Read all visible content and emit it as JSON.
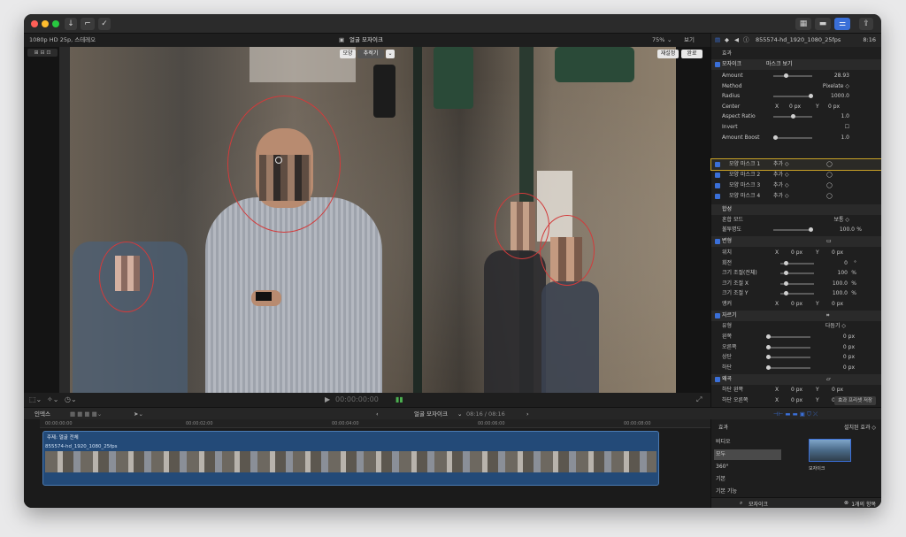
{
  "titlebar": {
    "buttons": [
      "↓",
      "⌐",
      "✓"
    ],
    "right_views": [
      "▦",
      "▬",
      "⚌"
    ]
  },
  "subbar": {
    "format": "1080p HD 25p, 스테레오",
    "clip_name": "얼굴 모자이크",
    "zoom": "75%",
    "view": "보기"
  },
  "viewer": {
    "shape_btn": "모양",
    "track_btn": "추적기",
    "replay_btn": "재설정",
    "done_btn": "완료",
    "timecode": "00:00:00:00"
  },
  "inspector": {
    "clip_id": "855574-hd_1920_1080_25fps",
    "duration": "8:16",
    "effects_title": "효과",
    "mosaic": {
      "name": "모자이크",
      "mask_view": "마스크 보기"
    },
    "params": [
      {
        "label": "Amount",
        "value": "28.93",
        "level": 0.3
      },
      {
        "label": "Method",
        "value": "Pixelate ◇"
      },
      {
        "label": "Radius",
        "value": "1000.0",
        "level": 1.0
      },
      {
        "label": "Center",
        "x_label": "X",
        "x": "0 px",
        "y_label": "Y",
        "y": "0 px"
      },
      {
        "label": "Aspect Ratio",
        "value": "1.0",
        "level": 0.5
      },
      {
        "label": "Invert",
        "value": "☐"
      },
      {
        "label": "Amount Boost",
        "value": "1.0",
        "level": 0.0
      }
    ],
    "masks": [
      {
        "name": "모양 마스크 1",
        "add": "추가 ◇"
      },
      {
        "name": "모양 마스크 2",
        "add": "추가 ◇"
      },
      {
        "name": "모양 마스크 3",
        "add": "추가 ◇"
      },
      {
        "name": "모양 마스크 4",
        "add": "추가 ◇"
      }
    ],
    "composite": {
      "title": "합성",
      "blend_label": "혼합 모드",
      "blend_value": "보통 ◇",
      "opacity_label": "불투명도",
      "opacity_value": "100.0",
      "opacity_unit": "%"
    },
    "transform": {
      "title": "변형",
      "rows": [
        {
          "label": "위치",
          "x": "0 px",
          "y": "0 px"
        },
        {
          "label": "회전",
          "value": "0",
          "unit": "°"
        },
        {
          "label": "크기 조절(전체)",
          "value": "100",
          "unit": "%"
        },
        {
          "label": "크기 조절 X",
          "value": "100.0",
          "unit": "%"
        },
        {
          "label": "크기 조절 Y",
          "value": "100.0",
          "unit": "%"
        },
        {
          "label": "앵커",
          "x": "0 px",
          "y": "0 px"
        }
      ]
    },
    "crop": {
      "title": "자르기",
      "type_label": "유형",
      "type_value": "다듬기 ◇",
      "rows": [
        {
          "label": "왼쪽",
          "value": "0 px"
        },
        {
          "label": "오른쪽",
          "value": "0 px"
        },
        {
          "label": "상단",
          "value": "0 px"
        },
        {
          "label": "하단",
          "value": "0 px"
        }
      ]
    },
    "distort": {
      "title": "왜곡",
      "rows": [
        {
          "label": "하단 왼쪽",
          "x": "0 px",
          "y": "0 px"
        },
        {
          "label": "하단 오른쪽",
          "x": "0 px",
          "y": "0 px"
        }
      ]
    },
    "save_preset": "효과 프리셋 저장"
  },
  "timeline_bar": {
    "index": "인덱스",
    "project": "얼굴 모자이크",
    "position": "08:16 / 08:16"
  },
  "timeline": {
    "ruler": [
      "00:00:00:00",
      "00:00:02:00",
      "00:00:04:00",
      "00:00:06:00",
      "00:00:08:00"
    ],
    "effect_label": "주제: 얼굴 전체",
    "clip_label": "855574-hd_1920_1080_25fps"
  },
  "effects_browser": {
    "title": "효과",
    "installed": "설치된 효과 ◇",
    "categories": [
      "비디오",
      "모두",
      "360°",
      "기본",
      "기본 기능"
    ],
    "selected_index": 1,
    "thumb_label": "모자이크",
    "search": "모자이크",
    "count": "1개의 항목"
  },
  "colors": {
    "accent": "#3a6fd8",
    "mask_ring": "#d23b3b",
    "clip": "#234a78",
    "highlight": "#c9a227"
  }
}
